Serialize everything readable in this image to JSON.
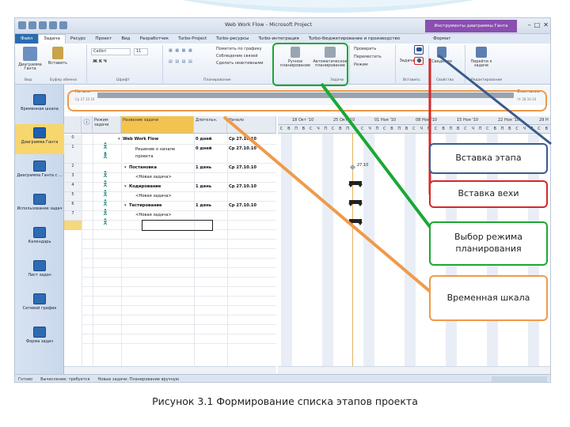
{
  "window": {
    "title": "Web Work Flow - Microsoft Project",
    "context_tab": "Инструменты диаграммы Ганта",
    "controls": [
      "–",
      "□",
      "✕"
    ]
  },
  "ribbon_tabs": [
    "Файл",
    "Задача",
    "Ресурс",
    "Проект",
    "Вид",
    "Разработчик",
    "Turbo-Project",
    "Turbo-ресурсы",
    "Turbo-интеграция",
    "Turbo-бюджетирование и производство",
    "Формат"
  ],
  "ribbon": {
    "gantt_label": "Диаграмма Ганта",
    "paste_label": "Вставить",
    "font_name": "Calibri",
    "font_size": "11",
    "mark_on_track": "Пометить по графику",
    "respect_links": "Соблюдение связей",
    "deactivate": "Сделать неактивными",
    "manual_label": "Ручное планирование",
    "auto_label": "Автоматическое планирование",
    "inspect": "Проверить",
    "move": "Переместить",
    "mode": "Режим",
    "task_label": "Задача",
    "info_label": "Сведения",
    "scroll_label": "Перейти к задаче",
    "groups": [
      "Вид",
      "Буфер обмена",
      "Шрифт",
      "Планирование",
      "Задачи",
      "Вставить",
      "Свойства",
      "Редактирование"
    ]
  },
  "timeline": {
    "start_label": "Начало",
    "start_date": "Ср 27.10.10",
    "end_label": "Окончание",
    "end_date": "Чт 28.10.10"
  },
  "view_bar": [
    {
      "label": "Временная шкала",
      "active": false
    },
    {
      "label": "Диаграмма Ганта",
      "active": true
    },
    {
      "label": "Диаграмма Ганта с ...",
      "active": false
    },
    {
      "label": "Использование задач",
      "active": false
    },
    {
      "label": "Календарь",
      "active": false
    },
    {
      "label": "Лист задач",
      "active": false
    },
    {
      "label": "Сетевой график",
      "active": false
    },
    {
      "label": "Форма задач",
      "active": false
    }
  ],
  "grid": {
    "headers": [
      "Режим задачи",
      "Название задачи",
      "Длительн.",
      "Начало"
    ],
    "rows": [
      {
        "id": "0",
        "name": "Web Work Flow",
        "duration": "0 дней",
        "start": "Ср 27.10.10",
        "bold": true,
        "indent": 0
      },
      {
        "id": "1",
        "name": "Решение о начале проекта",
        "duration": "0 дней",
        "start": "Ср 27.10.10",
        "bold": false,
        "indent": 2
      },
      {
        "id": "2",
        "name": "Постановка",
        "duration": "1 день",
        "start": "Ср 27.10.10",
        "bold": true,
        "indent": 1
      },
      {
        "id": "3",
        "name": "<Новая задача>",
        "duration": "",
        "start": "",
        "bold": false,
        "indent": 2
      },
      {
        "id": "4",
        "name": "Кодирование",
        "duration": "1 день",
        "start": "Ср 27.10.10",
        "bold": true,
        "indent": 1
      },
      {
        "id": "5",
        "name": "<Новая задача>",
        "duration": "",
        "start": "",
        "bold": false,
        "indent": 2
      },
      {
        "id": "6",
        "name": "Тестирование",
        "duration": "1 день",
        "start": "Ср 27.10.10",
        "bold": true,
        "indent": 1
      },
      {
        "id": "7",
        "name": "<Новая задача>",
        "duration": "",
        "start": "",
        "bold": false,
        "indent": 2
      }
    ]
  },
  "gantt": {
    "weeks": [
      "18 Окт '10",
      "25 Окт '10",
      "01 Ноя '10",
      "08 Ноя '10",
      "15 Ноя '10",
      "22 Ноя '10",
      "29 Н"
    ],
    "days": [
      "С",
      "В",
      "П",
      "В",
      "С",
      "Ч",
      "П",
      "С",
      "В",
      "П",
      "В",
      "С",
      "Ч",
      "П",
      "С",
      "В",
      "П",
      "В",
      "С",
      "Ч",
      "П",
      "С",
      "В",
      "П",
      "В",
      "С",
      "Ч",
      "П",
      "С",
      "В",
      "П",
      "В",
      "С",
      "Ч",
      "П",
      "С",
      "В"
    ],
    "milestone_label": "27.10"
  },
  "status_bar": {
    "ready": "Готово",
    "calc": "Вычисление: требуется",
    "new_tasks": "Новые задачи: Планирование вручную"
  },
  "callouts": {
    "insert_phase": "Вставка этапа",
    "insert_milestone": "Вставка вехи",
    "scheduling_mode": "Выбор режима планирования",
    "timeline": "Временная шкала"
  },
  "colors": {
    "blue": "#3a5b8c",
    "red": "#d62828",
    "green": "#1aa834",
    "orange": "#ef9a4a"
  },
  "caption": "Рисунок 3.1 Формирование списка этапов проекта"
}
